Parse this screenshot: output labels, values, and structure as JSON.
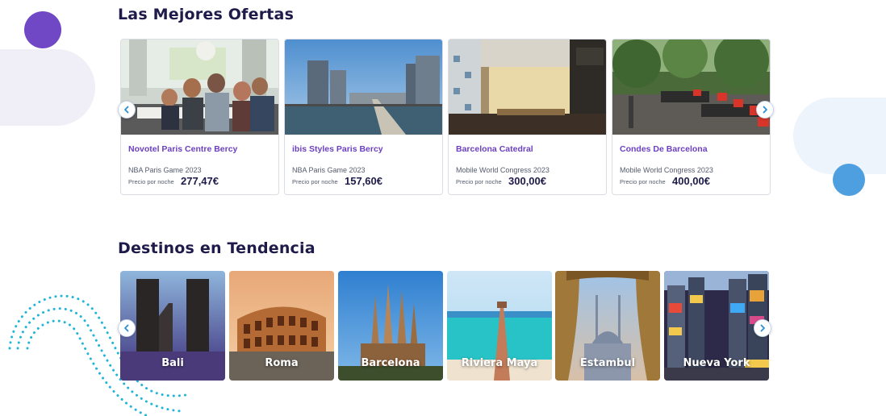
{
  "offers_section": {
    "title": "Las Mejores Ofertas",
    "price_label": "Precio por noche",
    "items": [
      {
        "name": "Novotel Paris Centre Bercy",
        "event": "NBA Paris Game 2023",
        "price": "277,47€"
      },
      {
        "name": "ibis Styles Paris Bercy",
        "event": "NBA Paris Game 2023",
        "price": "157,60€"
      },
      {
        "name": "Barcelona Catedral",
        "event": "Mobile World Congress 2023",
        "price": "300,00€"
      },
      {
        "name": "Condes De Barcelona",
        "event": "Mobile World Congress 2023",
        "price": "400,00€"
      }
    ]
  },
  "destinations_section": {
    "title": "Destinos en Tendencia",
    "items": [
      {
        "label": "Bali"
      },
      {
        "label": "Roma"
      },
      {
        "label": "Barcelona"
      },
      {
        "label": "Riviera Maya"
      },
      {
        "label": "Estambul"
      },
      {
        "label": "Nueva York"
      }
    ]
  },
  "icons": {
    "prev": "chevron-left-icon",
    "next": "chevron-right-icon"
  },
  "colors": {
    "title": "#1e1b4b",
    "hotel_name": "#6b3fbf",
    "accent_purple": "#7047c4",
    "accent_blue": "#4d9fe0",
    "dots": "#21b5d6"
  }
}
